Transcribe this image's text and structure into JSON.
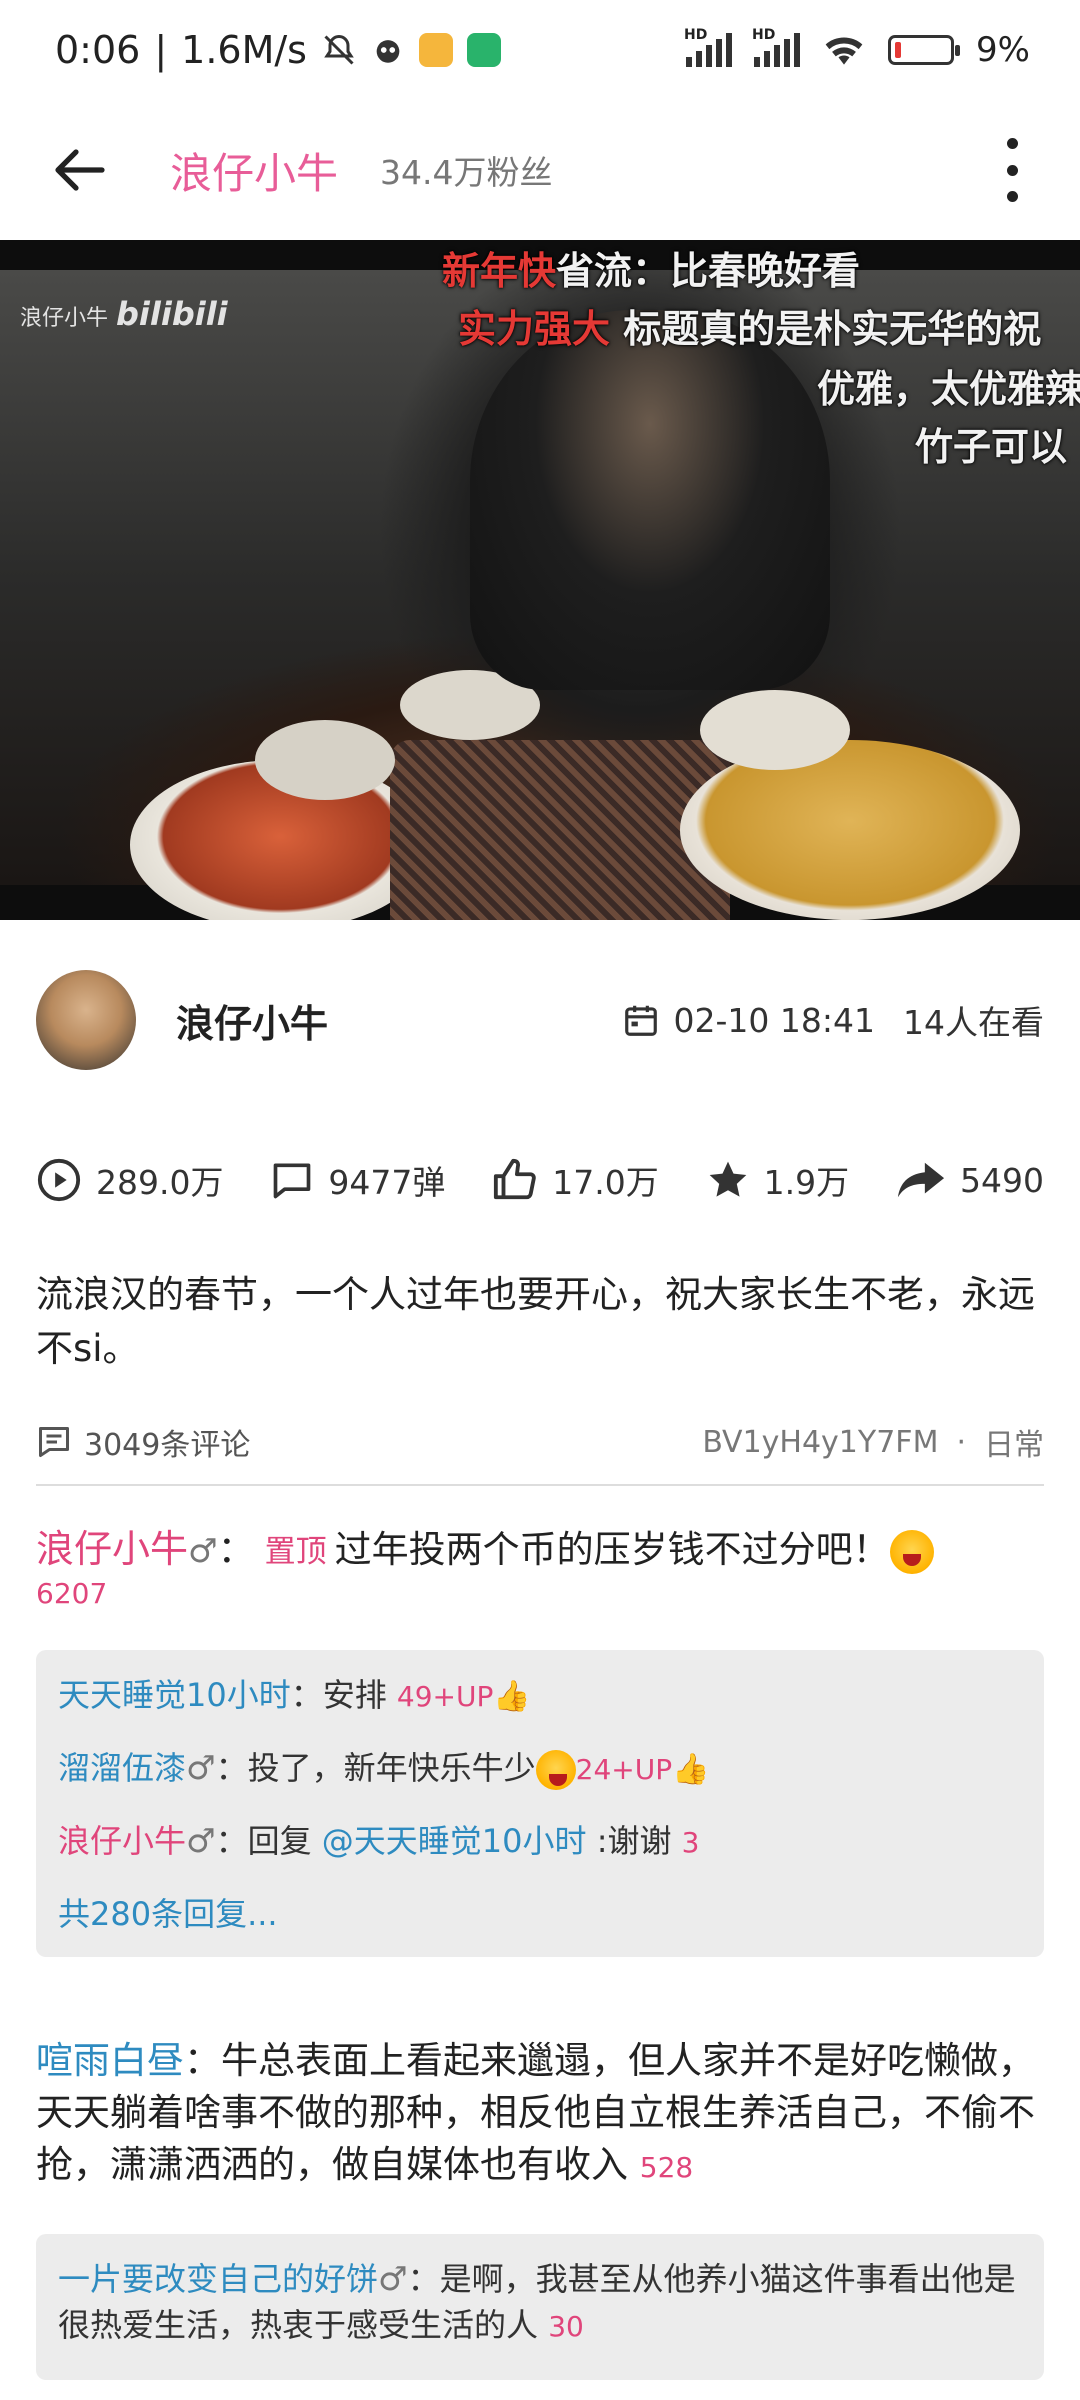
{
  "status": {
    "time": "0:06",
    "speed": "1.6M/s",
    "battery": "9%",
    "hd1": "HD",
    "hd2": "HD"
  },
  "appbar": {
    "title": "浪仔小牛",
    "fans": "34.4万粉丝"
  },
  "video": {
    "watermark_name": "浪仔小牛",
    "watermark_brand": "bilibili",
    "danmaku": [
      {
        "red": "新年快",
        "white": "省流：比春晚好看"
      },
      {
        "red": "实力强大",
        "white": " 标题真的是朴实无华的祝"
      },
      {
        "red": "",
        "white": "优雅，太优雅辣"
      },
      {
        "red": "",
        "white": "竹子可以"
      }
    ]
  },
  "author": {
    "name": "浪仔小牛",
    "datetime": "02-10 18:41",
    "watching": "14人在看"
  },
  "stats": {
    "views": "289.0万",
    "danmaku": "9477弹",
    "likes": "17.0万",
    "favorites": "1.9万",
    "shares": "5490"
  },
  "description": "流浪汉的春节，一个人过年也要开心，祝大家长生不老，永远不si。",
  "comments_header": {
    "count": "3049条评论",
    "bvid": "BV1yH4y1Y7FM",
    "separator": "·",
    "category": "日常"
  },
  "pinned_comment": {
    "user": "浪仔小牛",
    "gender": "♂",
    "colon": "：",
    "pin_label": "置顶",
    "text": "过年投两个币的压岁钱不过分吧！",
    "likes": "6207",
    "replies": [
      {
        "user": "天天睡觉10小时",
        "gender": "",
        "text": "：安排 ",
        "likes": "49+UP"
      },
      {
        "user": "溜溜伍漆",
        "gender": "♂",
        "text": "：投了，新年快乐牛少",
        "likes": "24+UP"
      },
      {
        "user": "浪仔小牛",
        "gender": "♂",
        "text_pre": "：回复 ",
        "mention": "@天天睡觉10小时",
        "text_post": " :谢谢 ",
        "likes": "3"
      }
    ],
    "more_replies": "共280条回复..."
  },
  "comment2": {
    "user": "喧雨白昼",
    "text": "：牛总表面上看起来邋遢，但人家并不是好吃懒做，天天躺着啥事不做的那种，相反他自立根生养活自己，不偷不抢，潇潇洒洒的，做自媒体也有收入 ",
    "likes": "528",
    "reply": {
      "user": "一片要改变自己的好饼",
      "gender": "♂",
      "text": "：是啊，我甚至从他养小猫这件事看出他是很热爱生活，热衷于感受生活的人 ",
      "likes": "30"
    }
  },
  "colors": {
    "accent_pink": "#e0457b",
    "link_blue": "#2e8bc0"
  }
}
